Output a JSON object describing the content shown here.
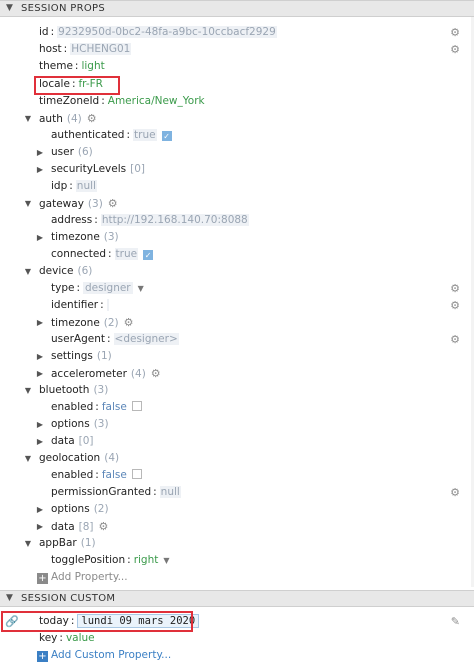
{
  "session_props": {
    "title": "SESSION PROPS",
    "rows": {
      "id": {
        "key": "id",
        "value": "9232950d-0bc2-48fa-a9bc-10ccbacf2929"
      },
      "host": {
        "key": "host",
        "value": "HCHENG01"
      },
      "theme": {
        "key": "theme",
        "value": "light"
      },
      "locale": {
        "key": "locale",
        "value": "fr-FR"
      },
      "timeZoneId": {
        "key": "timeZoneId",
        "value": "America/New_York"
      },
      "auth": {
        "key": "auth",
        "count": "(4)"
      },
      "authenticated": {
        "key": "authenticated",
        "value": "true"
      },
      "user": {
        "key": "user",
        "count": "(6)"
      },
      "securityLevels": {
        "key": "securityLevels",
        "count": "[0]"
      },
      "idp": {
        "key": "idp",
        "value": "null"
      },
      "gateway": {
        "key": "gateway",
        "count": "(3)"
      },
      "address": {
        "key": "address",
        "value": "http://192.168.140.70:8088"
      },
      "timezone": {
        "key": "timezone",
        "count": "(3)"
      },
      "connected": {
        "key": "connected",
        "value": "true"
      },
      "device": {
        "key": "device",
        "count": "(6)"
      },
      "type": {
        "key": "type",
        "value": "designer"
      },
      "identifier": {
        "key": "identifier",
        "value": ""
      },
      "device_timezone": {
        "key": "timezone",
        "count": "(2)"
      },
      "userAgent": {
        "key": "userAgent",
        "value": "<designer>"
      },
      "settings": {
        "key": "settings",
        "count": "(1)"
      },
      "accelerometer": {
        "key": "accelerometer",
        "count": "(4)"
      },
      "bluetooth": {
        "key": "bluetooth",
        "count": "(3)"
      },
      "bt_enabled": {
        "key": "enabled",
        "value": "false"
      },
      "bt_options": {
        "key": "options",
        "count": "(3)"
      },
      "bt_data": {
        "key": "data",
        "count": "[0]"
      },
      "geolocation": {
        "key": "geolocation",
        "count": "(4)"
      },
      "geo_enabled": {
        "key": "enabled",
        "value": "false"
      },
      "permissionGranted": {
        "key": "permissionGranted",
        "value": "null"
      },
      "geo_options": {
        "key": "options",
        "count": "(2)"
      },
      "geo_data": {
        "key": "data",
        "count": "[8]"
      },
      "appBar": {
        "key": "appBar",
        "count": "(1)"
      },
      "togglePosition": {
        "key": "togglePosition",
        "value": "right"
      }
    },
    "add_property": "Add Property..."
  },
  "session_custom": {
    "title": "SESSION CUSTOM",
    "today": {
      "key": "today",
      "value": "lundi 09 mars 2020"
    },
    "keyrow": {
      "key": "key",
      "value": "value"
    },
    "add_custom": "Add Custom Property..."
  },
  "colors": {
    "highlight": "#e0303a",
    "string": "#3a9a4a",
    "bool": "#5b86b8",
    "link": "#3a7fc4"
  },
  "icons": {
    "collapse": "chevron-down-icon",
    "gear": "gear-icon",
    "link": "link-icon",
    "expand": "caret-right-icon"
  }
}
